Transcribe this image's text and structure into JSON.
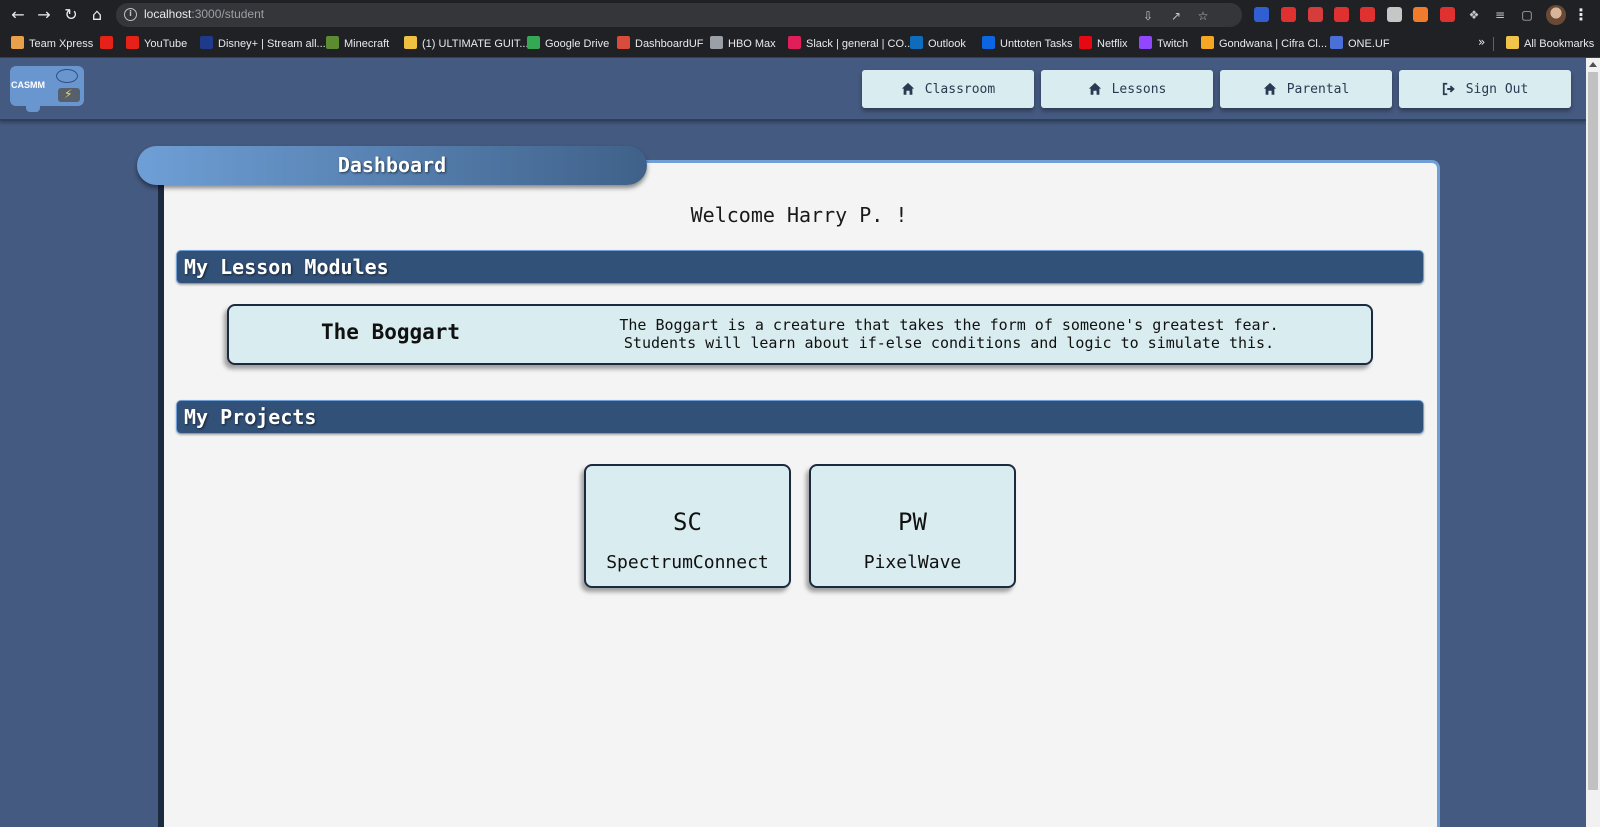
{
  "browser": {
    "url_host": "localhost",
    "url_path": ":3000/student",
    "bookmarks": [
      {
        "label": "Team Xpress",
        "color": "#e8a04a"
      },
      {
        "label": "",
        "color": "#e62117"
      },
      {
        "label": "YouTube",
        "color": "#e62117"
      },
      {
        "label": "Disney+ | Stream all...",
        "color": "#1e3a8a"
      },
      {
        "label": "Minecraft",
        "color": "#5b8c32"
      },
      {
        "label": "(1) ULTIMATE GUIT...",
        "color": "#f0c040"
      },
      {
        "label": "Google Drive",
        "color": "#34a853"
      },
      {
        "label": "DashboardUF",
        "color": "#d94b3a"
      },
      {
        "label": "HBO Max",
        "color": "#9aa0a6"
      },
      {
        "label": "Slack | general | CO...",
        "color": "#e01e5a"
      },
      {
        "label": "Outlook",
        "color": "#0f6cbd"
      },
      {
        "label": "Unttoten Tasks",
        "color": "#0c66e4"
      },
      {
        "label": "Netflix",
        "color": "#e50914"
      },
      {
        "label": "Twitch",
        "color": "#9146ff"
      },
      {
        "label": "Gondwana | Cifra Cl...",
        "color": "#f5a623"
      },
      {
        "label": "ONE.UF",
        "color": "#4a6fd8"
      }
    ],
    "all_bookmarks_label": "All Bookmarks",
    "extension_colors": [
      "#2f5fd0",
      "#e03131",
      "#d63c3c",
      "#e03131",
      "#e03131",
      "#c4c7c5",
      "#f07c2b",
      "#e03131",
      "#c4c7c5",
      "#c4c7c5",
      "#e8eaed"
    ]
  },
  "app": {
    "logo_text": "CASMM",
    "nav": [
      {
        "label": "Classroom",
        "icon": "home-icon"
      },
      {
        "label": "Lessons",
        "icon": "home-icon"
      },
      {
        "label": "Parental",
        "icon": "home-icon"
      },
      {
        "label": "Sign Out",
        "icon": "sign-out-icon"
      }
    ]
  },
  "dashboard": {
    "tab_title": "Dashboard",
    "welcome": "Welcome Harry P. !",
    "lessons_heading": "My Lesson Modules",
    "lesson": {
      "title": "The Boggart",
      "description_line1": "The Boggart is a creature that takes the form of someone's greatest fear.",
      "description_line2": "Students will learn about if-else conditions and logic to simulate this."
    },
    "projects_heading": "My Projects",
    "projects": [
      {
        "abbr": "SC",
        "name": "SpectrumConnect"
      },
      {
        "abbr": "PW",
        "name": "PixelWave"
      }
    ]
  }
}
